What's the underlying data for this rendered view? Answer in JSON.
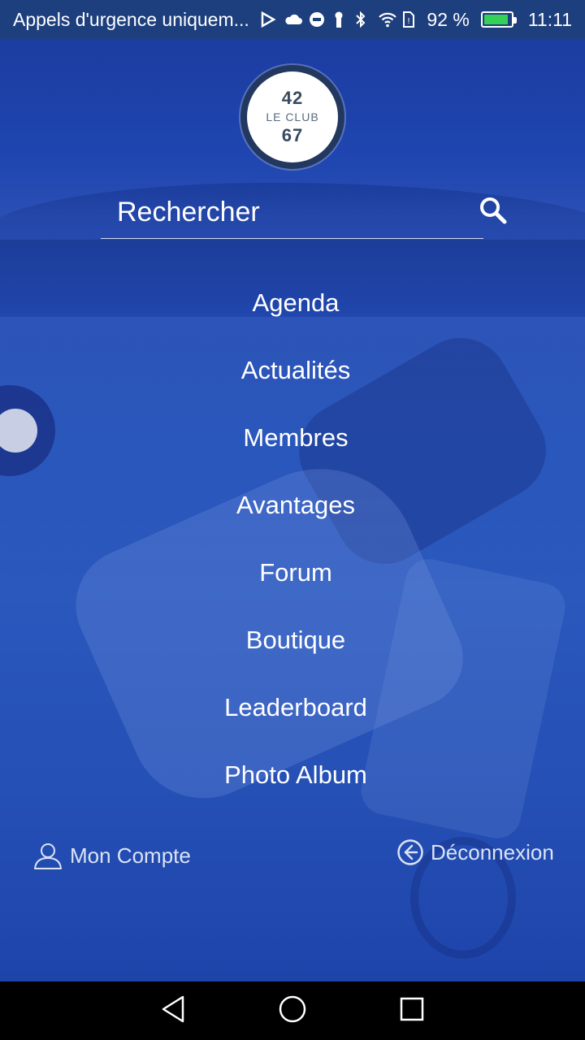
{
  "status_bar": {
    "carrier": "Appels d'urgence uniquem...",
    "battery_percent": "92 %",
    "battery_level": 0.92,
    "time": "11:11",
    "left_icons": [
      "play-store-icon",
      "cloud-icon",
      "vpn-icon",
      "key-icon"
    ],
    "right_icons": [
      "bluetooth-icon",
      "wifi-icon",
      "sim-icon",
      "battery-icon"
    ]
  },
  "logo": {
    "top": "42",
    "middle": "LE CLUB",
    "bottom": "67"
  },
  "search": {
    "placeholder": "Rechercher"
  },
  "menu": {
    "items": [
      {
        "label": "Agenda"
      },
      {
        "label": "Actualités"
      },
      {
        "label": "Membres"
      },
      {
        "label": "Avantages"
      },
      {
        "label": "Forum"
      },
      {
        "label": "Boutique"
      },
      {
        "label": "Leaderboard"
      },
      {
        "label": "Photo Album"
      }
    ]
  },
  "footer": {
    "account_label": "Mon Compte",
    "logout_label": "Déconnexion"
  },
  "colors": {
    "background": "#2247b0",
    "status_bar": "#1d3f7d",
    "text": "#ffffff",
    "battery_fill": "#34d058"
  }
}
